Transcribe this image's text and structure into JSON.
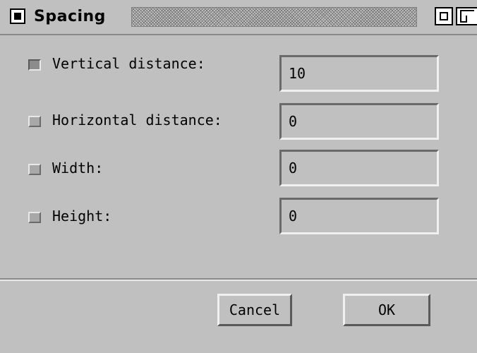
{
  "window": {
    "title": "Spacing"
  },
  "icons": {
    "window_menu": "window-menu-icon",
    "iconify": "iconify-icon",
    "maximize": "maximize-icon"
  },
  "form": {
    "fields": [
      {
        "label": "Vertical distance:",
        "value": "10",
        "checked": true
      },
      {
        "label": "Horizontal distance:",
        "value": "0",
        "checked": false
      },
      {
        "label": "Width:",
        "value": "0",
        "checked": false
      },
      {
        "label": "Height:",
        "value": "0",
        "checked": false
      }
    ]
  },
  "buttons": {
    "cancel_label": "Cancel",
    "ok_label": "OK"
  }
}
